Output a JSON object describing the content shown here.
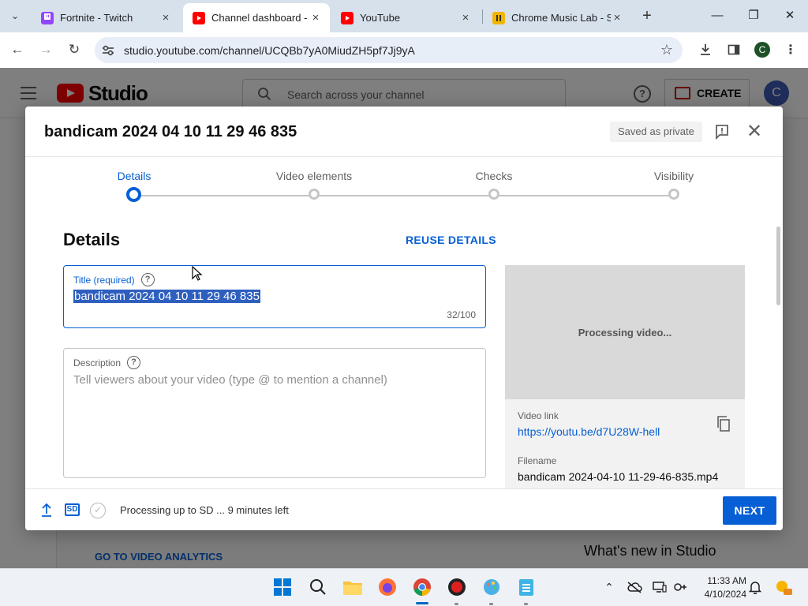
{
  "browser": {
    "tabs": [
      {
        "title": "Fortnite - Twitch",
        "active": false
      },
      {
        "title": "Channel dashboard - Y",
        "active": true
      },
      {
        "title": "YouTube",
        "active": false
      },
      {
        "title": "Chrome Music Lab - S",
        "active": false
      }
    ],
    "url": "studio.youtube.com/channel/UCQBb7yA0MiudZH5pf7Jj9yA",
    "profile_initial": "C"
  },
  "studio": {
    "logo_text": "Studio",
    "search_placeholder": "Search across your channel",
    "create_label": "CREATE",
    "avatar_initial": "C",
    "bottom_link": "GO TO VIDEO ANALYTICS",
    "whats_new": "What's new in Studio"
  },
  "dialog": {
    "title": "bandicam 2024 04 10 11 29 46 835",
    "saved_badge": "Saved as private",
    "steps": [
      {
        "label": "Details",
        "active": true
      },
      {
        "label": "Video elements",
        "active": false
      },
      {
        "label": "Checks",
        "active": false
      },
      {
        "label": "Visibility",
        "active": false
      }
    ],
    "section_title": "Details",
    "reuse_label": "REUSE DETAILS",
    "title_field": {
      "label": "Title (required)",
      "value": "bandicam 2024 04 10 11 29 46 835",
      "count": "32/100"
    },
    "description_field": {
      "label": "Description",
      "placeholder": "Tell viewers about your video (type @ to mention a channel)"
    },
    "preview": {
      "processing": "Processing video...",
      "video_link_label": "Video link",
      "video_link": "https://youtu.be/d7U28W-hell",
      "filename_label": "Filename",
      "filename": "bandicam 2024-04-10 11-29-46-835.mp4"
    },
    "footer": {
      "sd_badge": "SD",
      "status": "Processing up to SD ... 9 minutes left",
      "next_label": "NEXT"
    }
  },
  "taskbar": {
    "time": "11:33 AM",
    "date": "4/10/2024"
  }
}
